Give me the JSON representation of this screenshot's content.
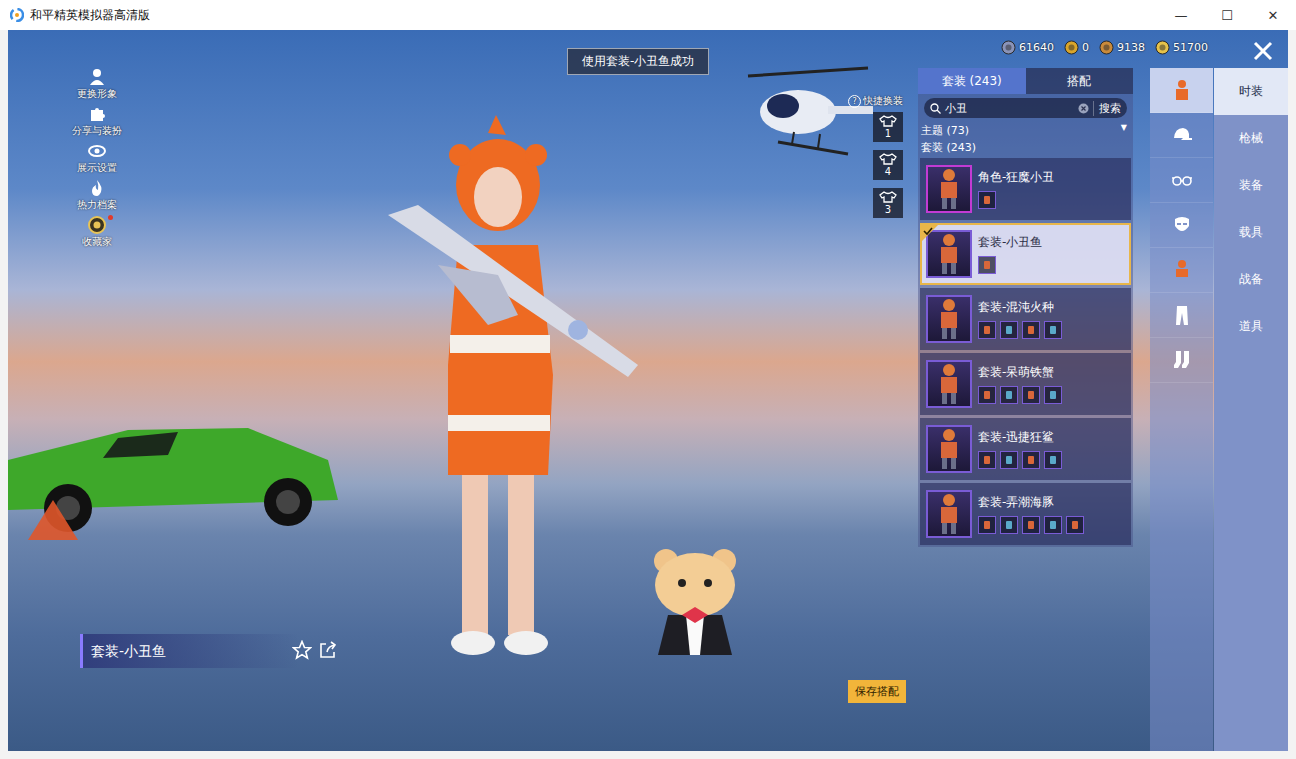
{
  "window": {
    "title": "和平精英模拟器高清版",
    "controls": [
      "—",
      "☐",
      "✕"
    ]
  },
  "notice": "使用套装-小丑鱼成功",
  "currencies": [
    {
      "value": "61640"
    },
    {
      "value": "0"
    },
    {
      "value": "9138"
    },
    {
      "value": "51700"
    }
  ],
  "left_menu": [
    {
      "label": "更换形象",
      "badge": false
    },
    {
      "label": "分享与装扮",
      "badge": false
    },
    {
      "label": "展示设置",
      "badge": false
    },
    {
      "label": "热力档案",
      "badge": false
    },
    {
      "label": "收藏家",
      "badge": true
    }
  ],
  "quick_change": {
    "help": "?",
    "label": "快捷换装",
    "slots": [
      "1",
      "4",
      "3"
    ]
  },
  "panel": {
    "tabs": [
      {
        "label": "套装 (243)",
        "selected": true
      },
      {
        "label": "搭配",
        "selected": false
      }
    ],
    "search": {
      "value": "小丑",
      "button": "搜索"
    },
    "filter": {
      "label": "主题 (73)",
      "arrow": "▼"
    },
    "section": "套装 (243)",
    "outfits": [
      {
        "name": "角色-狂魔小丑",
        "parts": 1,
        "selected": false,
        "color": "#c23bd4"
      },
      {
        "name": "套装-小丑鱼",
        "parts": 1,
        "selected": true,
        "color": "#7a5cd6"
      },
      {
        "name": "套装-混沌火种",
        "parts": 4,
        "selected": false,
        "color": "#7a5cd6"
      },
      {
        "name": "套装-呆萌铁蟹",
        "parts": 4,
        "selected": false,
        "color": "#7a5cd6"
      },
      {
        "name": "套装-迅捷狂鲨",
        "parts": 4,
        "selected": false,
        "color": "#7a5cd6"
      },
      {
        "name": "套装-弄潮海豚",
        "parts": 5,
        "selected": false,
        "color": "#7a5cd6"
      }
    ]
  },
  "categories": [
    {
      "selected": true
    },
    {
      "selected": false
    },
    {
      "selected": false
    },
    {
      "selected": false
    },
    {
      "selected": false
    },
    {
      "selected": false
    },
    {
      "selected": false
    }
  ],
  "main_tabs": [
    {
      "label": "时装",
      "selected": true
    },
    {
      "label": "枪械",
      "selected": false
    },
    {
      "label": "装备",
      "selected": false
    },
    {
      "label": "载具",
      "selected": false
    },
    {
      "label": "战备",
      "selected": false
    },
    {
      "label": "道具",
      "selected": false
    }
  ],
  "nameplate": {
    "name": "套装-小丑鱼"
  },
  "save_button": "保存搭配"
}
